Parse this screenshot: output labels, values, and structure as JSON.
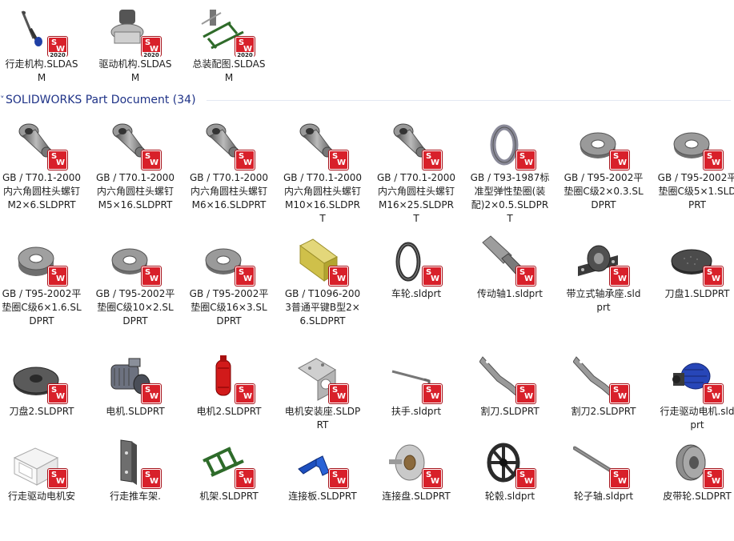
{
  "assemblies": [
    {
      "name": "行走机构.SLDASM",
      "icon": "walking-mechanism-thumbnail-icon"
    },
    {
      "name": "驱动机构.SLDASM",
      "icon": "drive-mechanism-thumbnail-icon"
    },
    {
      "name": "总装配图.SLDASM",
      "icon": "main-assembly-thumbnail-icon"
    }
  ],
  "sw_badge_year": "2020",
  "group": {
    "title": "SOLIDWORKS Part Document (34)",
    "chevron": "˅"
  },
  "parts": [
    {
      "name": "GB / T70.1-2000内六角圆柱头螺钉M2×6.SLDPRT",
      "shape": "bolt"
    },
    {
      "name": "GB / T70.1-2000内六角圆柱头螺钉M5×16.SLDPRT",
      "shape": "bolt"
    },
    {
      "name": "GB / T70.1-2000内六角圆柱头螺钉M6×16.SLDPRT",
      "shape": "bolt"
    },
    {
      "name": "GB / T70.1-2000内六角圆柱头螺钉M10×16.SLDPRT",
      "shape": "bolt"
    },
    {
      "name": "GB / T70.1-2000内六角圆柱头螺钉M16×25.SLDPRT",
      "shape": "bolt"
    },
    {
      "name": "GB / T93-1987标准型弹性垫圈(装配)2×0.5.SLDPRT",
      "shape": "spring-washer"
    },
    {
      "name": "GB / T95-2002平垫圈C级2×0.3.SLDPRT",
      "shape": "washer"
    },
    {
      "name": "GB / T95-2002平垫圈C级5×1.SLDPRT",
      "shape": "washer"
    },
    {
      "name": "GB / T95-2002平垫圈C级6×1.6.SLDPRT",
      "shape": "washer-thick"
    },
    {
      "name": "GB / T95-2002平垫圈C级10×2.SLDPRT",
      "shape": "washer"
    },
    {
      "name": "GB / T95-2002平垫圈C级16×3.SLDPRT",
      "shape": "washer"
    },
    {
      "name": "GB / T1096-2003普通平键B型2×6.SLDPRT",
      "shape": "key"
    },
    {
      "name": "车轮.sldprt",
      "shape": "ring"
    },
    {
      "name": "传动轴1.sldprt",
      "shape": "shaft"
    },
    {
      "name": "带立式轴承座.sldprt",
      "shape": "bearing"
    },
    {
      "name": "刀盘1.SLDPRT",
      "shape": "disc"
    },
    {
      "name": "刀盘2.SLDPRT",
      "shape": "blade-disc"
    },
    {
      "name": "电机.SLDPRT",
      "shape": "motor"
    },
    {
      "name": "电机2.SLDPRT",
      "shape": "motor-red"
    },
    {
      "name": "电机安装座.SLDPRT",
      "shape": "bracket"
    },
    {
      "name": "扶手.sldprt",
      "shape": "handle"
    },
    {
      "name": "割刀.SLDPRT",
      "shape": "cutter"
    },
    {
      "name": "割刀2.SLDPRT",
      "shape": "cutter"
    },
    {
      "name": "行走驱动电机.sldprt",
      "shape": "motor-blue"
    },
    {
      "name": "行走驱动电机安",
      "shape": "frame-box"
    },
    {
      "name": "行走推车架.",
      "shape": "plate"
    },
    {
      "name": "机架.SLDPRT",
      "shape": "rack"
    },
    {
      "name": "连接板.SLDPRT",
      "shape": "link-plate"
    },
    {
      "name": "连接盘.SLDPRT",
      "shape": "pulley-disc"
    },
    {
      "name": "轮毂.sldprt",
      "shape": "hub"
    },
    {
      "name": "轮子轴.sldprt",
      "shape": "axle"
    },
    {
      "name": "皮带轮.SLDPRT",
      "shape": "belt-pulley"
    }
  ]
}
